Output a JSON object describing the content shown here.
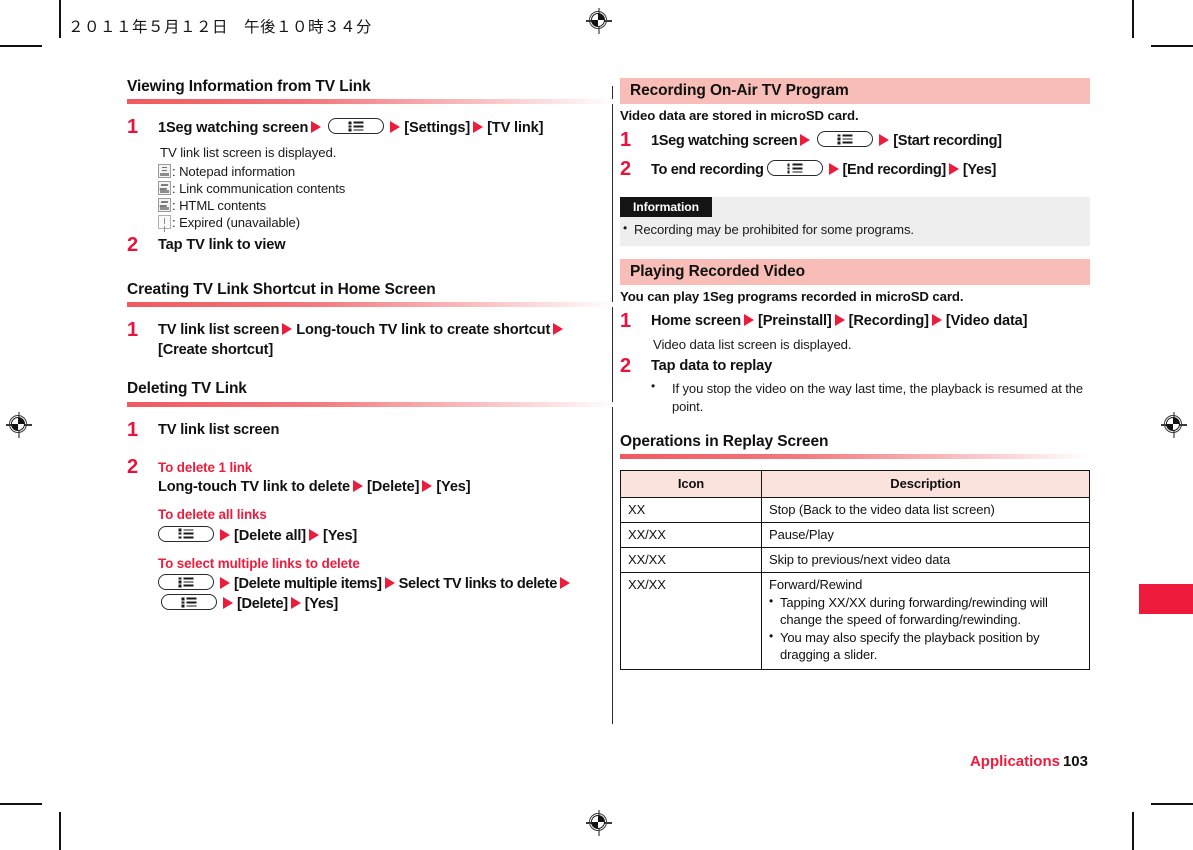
{
  "header": {
    "timestamp": "２０１１年５月１２日　午後１０時３４分"
  },
  "left_column": {
    "section1": {
      "heading": "Viewing Information from TV Link",
      "steps": [
        {
          "num": "1",
          "parts": [
            "1Seg watching screen",
            "ARROW",
            "MENUKEY",
            "ARROW",
            "[Settings]",
            "ARROW",
            "[TV link]"
          ],
          "text_a": "1Seg watching screen",
          "text_b": "[Settings]",
          "text_c": "[TV link]"
        },
        {
          "num": "2",
          "title": "Tap TV link to view"
        }
      ],
      "note": "TV link list screen is displayed.",
      "legend": [
        {
          "icon": "notepad-icon",
          "label": ": Notepad information"
        },
        {
          "icon": "link-communication-icon",
          "label": ": Link communication contents"
        },
        {
          "icon": "html-contents-icon",
          "label": ": HTML contents"
        },
        {
          "icon": "expired-icon",
          "label": ": Expired (unavailable)"
        }
      ]
    },
    "section2": {
      "heading": "Creating TV Link Shortcut in Home Screen",
      "step_num": "1",
      "text_a": "TV link list screen",
      "text_b": "Long-touch TV link to create shortcut",
      "text_c": "[Create shortcut]"
    },
    "section3": {
      "heading": "Deleting TV Link",
      "step1_num": "1",
      "step1_text": "TV link list screen",
      "step2_num": "2",
      "groups": [
        {
          "subhead": "To delete 1 link",
          "text_a": "Long-touch TV link to delete",
          "text_b": "[Delete]",
          "text_c": "[Yes]"
        },
        {
          "subhead": "To delete all links",
          "text_a": "[Delete all]",
          "text_b": "[Yes]"
        },
        {
          "subhead": "To select multiple links to delete",
          "text_a": "[Delete multiple items]",
          "text_b": "Select TV links to delete",
          "text_c": "[Delete]",
          "text_d": "[Yes]"
        }
      ]
    }
  },
  "right_column": {
    "recording": {
      "heading": "Recording On-Air TV Program",
      "lead": "Video data are stored in microSD card.",
      "step1_num": "1",
      "step1_a": "1Seg watching screen",
      "step1_b": "[Start recording]",
      "step2_num": "2",
      "step2_a": "To end recording",
      "step2_b": "[End recording]",
      "step2_c": "[Yes]"
    },
    "information": {
      "tag": "Information",
      "items": [
        "Recording may be prohibited for some programs."
      ]
    },
    "playing": {
      "heading": "Playing Recorded Video",
      "lead": "You can play 1Seg programs recorded in microSD card.",
      "step1_num": "1",
      "step1_a": "Home screen",
      "step1_b": "[Preinstall]",
      "step1_c": "[Recording]",
      "step1_d": "[Video data]",
      "step1_note": "Video data list screen is displayed.",
      "step2_num": "2",
      "step2_title": "Tap data to replay",
      "step2_bullet": "If you stop the video on the way last time, the playback is resumed at the point."
    },
    "operations": {
      "heading": "Operations in Replay Screen",
      "table": {
        "columns": [
          "Icon",
          "Description"
        ],
        "rows": [
          {
            "icon": "XX",
            "description": "Stop (Back to the video data list screen)",
            "bullets": []
          },
          {
            "icon": "XX/XX",
            "description": "Pause/Play",
            "bullets": []
          },
          {
            "icon": "XX/XX",
            "description": "Skip to previous/next video data",
            "bullets": []
          },
          {
            "icon": "XX/XX",
            "description": "Forward/Rewind",
            "bullets": [
              "Tapping XX/XX during forwarding/rewinding will change the speed of forwarding/rewinding.",
              "You may also specify the playback position by dragging a slider."
            ]
          }
        ]
      }
    }
  },
  "footer": {
    "chapter": "Applications",
    "page_number": "103"
  },
  "colors": {
    "accent_red": "#ec1c3d",
    "heading_bar_pink": "#f7bdb6",
    "table_header_pink": "#fbe2dc",
    "info_panel_gray": "#eeeeee",
    "thumb_tab_red": "#ed1a3b"
  }
}
